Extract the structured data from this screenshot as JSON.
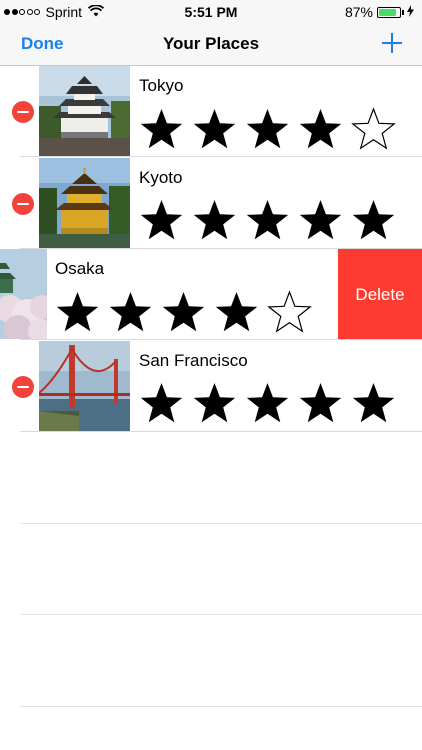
{
  "status_bar": {
    "carrier": "Sprint",
    "time": "5:51 PM",
    "battery_percent": "87%",
    "battery_level": 0.87,
    "signal_bars_filled": 2,
    "signal_bars_total": 5
  },
  "nav": {
    "done_label": "Done",
    "title": "Your Places",
    "add_icon": "plus-icon"
  },
  "places": [
    {
      "name": "Tokyo",
      "rating": 4,
      "max_rating": 5,
      "photo": "japanese-castle"
    },
    {
      "name": "Kyoto",
      "rating": 5,
      "max_rating": 5,
      "photo": "golden-pavilion"
    },
    {
      "name": "Osaka",
      "rating": 4,
      "max_rating": 5,
      "photo": "castle-cherry-blossoms",
      "swiped": true
    },
    {
      "name": "San Francisco",
      "rating": 5,
      "max_rating": 5,
      "photo": "golden-gate-bridge"
    }
  ],
  "swipe_action": {
    "delete_label": "Delete"
  },
  "colors": {
    "tint": "#1a7ef0",
    "delete_red": "#fd3b30",
    "delete_control": "#f2433a",
    "battery_green": "#4cd964"
  }
}
